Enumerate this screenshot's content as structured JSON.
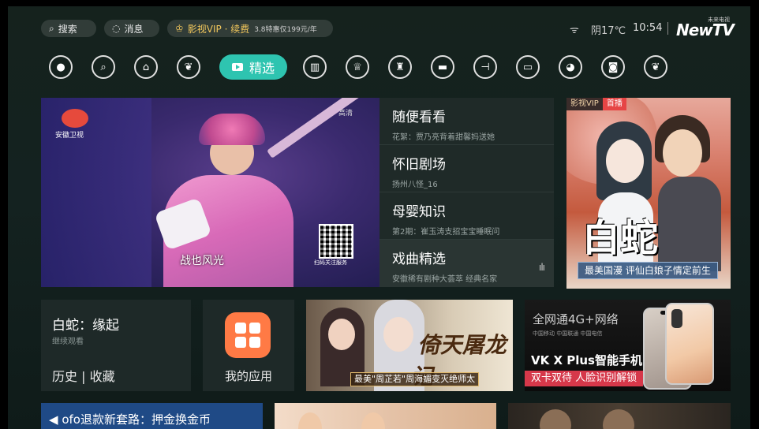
{
  "topbar": {
    "search_label": "搜索",
    "messages_label": "消息",
    "vip_label": "影视VIP · 续费",
    "vip_promo": "3.8特惠仅199元/年",
    "weather": "阴17℃",
    "time": "10:54",
    "brand_small": "未来电视",
    "brand_main": "NewTV"
  },
  "nav": {
    "items": [
      {
        "icon": "user-icon"
      },
      {
        "icon": "search-icon"
      },
      {
        "icon": "shop-icon"
      },
      {
        "icon": "balloon-icon"
      },
      {
        "icon": "tv-icon",
        "label": "精选",
        "active": true
      },
      {
        "icon": "book-icon"
      },
      {
        "icon": "crown-icon"
      },
      {
        "icon": "toys-icon"
      },
      {
        "icon": "movie-clapper-icon"
      },
      {
        "icon": "fitness-icon"
      },
      {
        "icon": "tv-series-icon"
      },
      {
        "icon": "sports-icon"
      },
      {
        "icon": "gamepad-icon"
      },
      {
        "icon": "balloon-icon"
      }
    ],
    "active_color": "#2ec4b0"
  },
  "hero": {
    "channel_name": "安徽卫视",
    "quality": "高清",
    "subtitle": "战也风光",
    "qr_label": "扫码关注服务"
  },
  "list": [
    {
      "title": "随便看看",
      "subtitle": "花絮：贾乃亮背着甜馨妈送她"
    },
    {
      "title": "怀旧剧场",
      "subtitle": "扬州八怪_16"
    },
    {
      "title": "母婴知识",
      "subtitle": "第2期：崔玉涛支招宝宝睡眠问"
    },
    {
      "title": "戏曲精选",
      "subtitle": "安徽稀有剧种大荟萃 经典名家"
    }
  ],
  "poster": {
    "tag_vip": "影视VIP",
    "tag_first": "首播",
    "title_art": "白蛇",
    "caption": "最美国漫 评仙白娘子情定前生"
  },
  "continue": {
    "title": "白蛇：缘起",
    "subtitle": "继续观看",
    "links": "历史 | 收藏"
  },
  "apps": {
    "label": "我的应用",
    "color": "#ff7a45"
  },
  "drama": {
    "calligraphy": "倚天屠龙记",
    "caption": "最美\"周芷若\"周海媚变灭绝师太"
  },
  "ad": {
    "top_text": "全网通4G+网络",
    "carriers": "中国移动  中国联通  中国电信",
    "brand": "VK X Plus智能手机",
    "slogan": "双卡双待 人脸识别解锁",
    "slogan_color": "#d6384a"
  },
  "bottom": {
    "news_text": "ofo退款新套路：押金换金币"
  }
}
